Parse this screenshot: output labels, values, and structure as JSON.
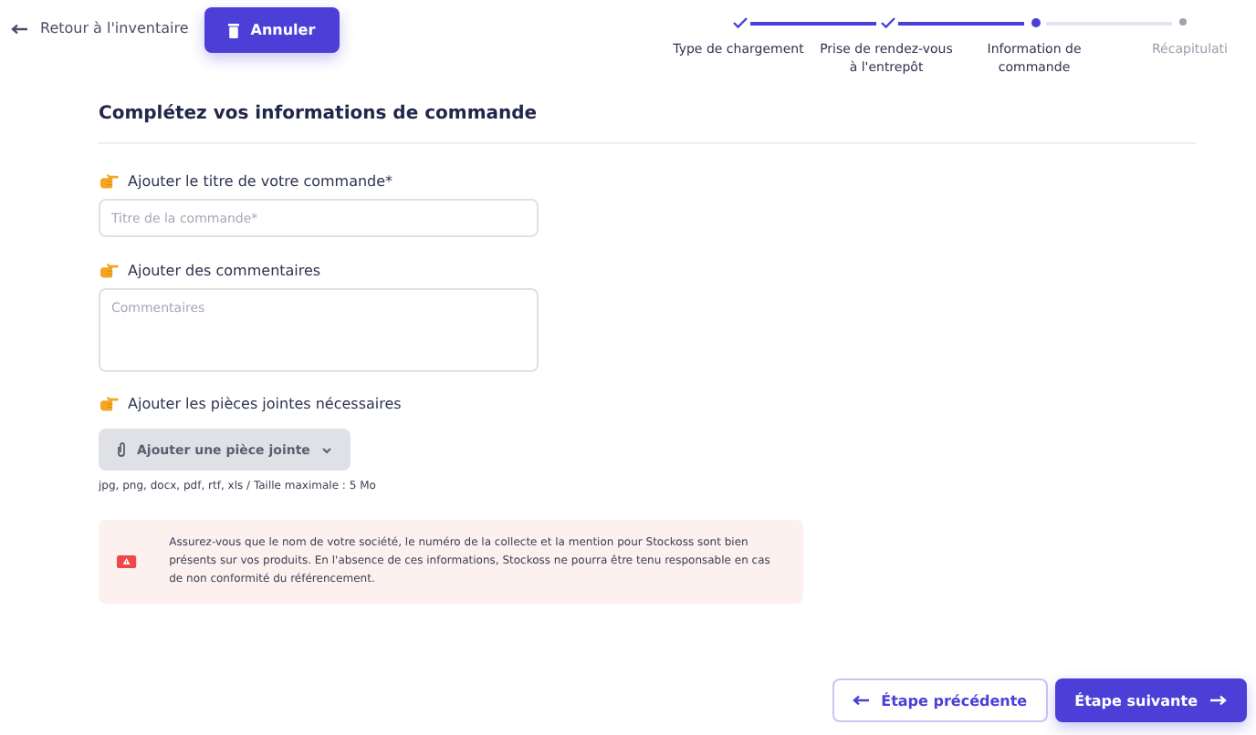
{
  "top_bar": {
    "back_link": "Retour à l'inventaire",
    "cancel_button": "Annuler"
  },
  "stepper": [
    {
      "label": "Type de chargement",
      "kind": "done"
    },
    {
      "label": "Prise de rendez-vous à l'entrepôt",
      "kind": "done"
    },
    {
      "label": "Information de commande",
      "kind": "current"
    },
    {
      "label": "Récapitulati",
      "kind": "upcoming"
    }
  ],
  "heading": "Complétez vos informations de commande",
  "fields": [
    {
      "label": "Ajouter le titre de votre commande*",
      "kind": "input",
      "placeholder": "Titre de la commande*"
    },
    {
      "label": "Ajouter des commentaires",
      "kind": "textarea",
      "placeholder": "Commentaires"
    },
    {
      "label": "Ajouter les pièces jointes nécessaires",
      "kind": "attachment",
      "button": "Ajouter une pièce jointe",
      "hint": "jpg, png, docx, pdf, rtf, xls / Taille maximale : 5 Mo"
    }
  ],
  "alert": "Assurez-vous que le nom de votre société, le numéro de la collecte et la mention pour Stockoss sont bien présents sur vos produits. En l'absence de ces informations, Stockoss ne pourra être tenu responsable en cas de non conformité du référencement.",
  "footer": {
    "previous_button": "Étape précédente",
    "next_button": "Étape suivante"
  }
}
